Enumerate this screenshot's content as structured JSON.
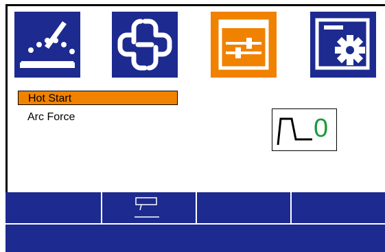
{
  "tabs": [
    {
      "name": "welding-process",
      "icon": "welding-bead-icon",
      "active": false
    },
    {
      "name": "connection",
      "icon": "chain-link-icon",
      "active": false
    },
    {
      "name": "parameters",
      "icon": "sliders-icon",
      "active": true
    },
    {
      "name": "settings",
      "icon": "window-gear-icon",
      "active": false
    }
  ],
  "parameters": {
    "items": [
      {
        "label": "Hot Start",
        "selected": true
      },
      {
        "label": "Arc Force",
        "selected": false
      }
    ]
  },
  "indicator": {
    "icon": "hot-start-curve-icon",
    "value": "0"
  },
  "softkeys": {
    "icons": [
      "",
      "input-field-icon",
      "",
      ""
    ]
  },
  "colors": {
    "tab_blue": "#1d2a8f",
    "tab_active": "#f08200",
    "highlight": "#f08200",
    "value_green": "#1a9a3c",
    "softkey_bar": "#1d2a8f"
  }
}
